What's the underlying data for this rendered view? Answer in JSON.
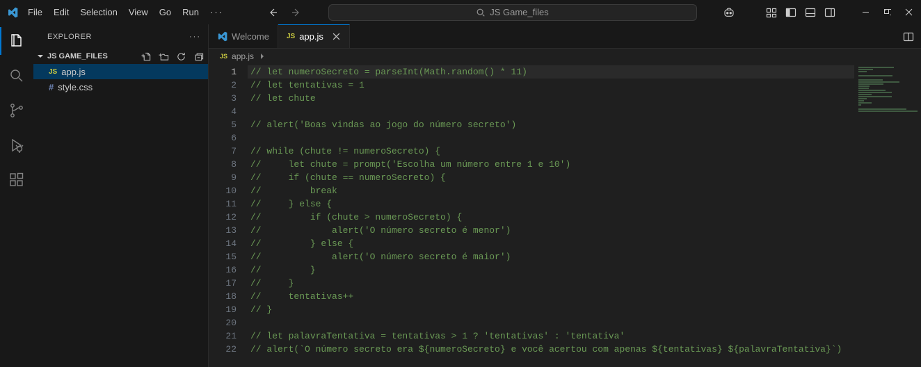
{
  "titlebar": {
    "menu": [
      "File",
      "Edit",
      "Selection",
      "View",
      "Go",
      "Run"
    ],
    "more": "···",
    "search_placeholder": "JS Game_files"
  },
  "sidebar": {
    "title": "EXPLORER",
    "folder": "JS GAME_FILES",
    "files": [
      {
        "name": "app.js",
        "icon": "JS",
        "selected": true
      },
      {
        "name": "style.css",
        "icon": "#",
        "selected": false
      }
    ]
  },
  "tabs": [
    {
      "label": "Welcome",
      "active": false,
      "icon": "vscode"
    },
    {
      "label": "app.js",
      "active": true,
      "icon": "JS"
    }
  ],
  "breadcrumb": {
    "icon": "JS",
    "label": "app.js"
  },
  "code_lines": [
    "// let numeroSecreto = parseInt(Math.random() * 11)",
    "// let tentativas = 1",
    "// let chute",
    "",
    "// alert('Boas vindas ao jogo do número secreto')",
    "",
    "// while (chute != numeroSecreto) {",
    "//     let chute = prompt('Escolha um número entre 1 e 10')",
    "//     if (chute == numeroSecreto) {",
    "//         break",
    "//     } else {",
    "//         if (chute > numeroSecreto) {",
    "//             alert('O número secreto é menor')",
    "//         } else {",
    "//             alert('O número secreto é maior')",
    "//         }",
    "//     }",
    "//     tentativas++",
    "// }",
    "",
    "// let palavraTentativa = tentativas > 1 ? 'tentativas' : 'tentativa'",
    "// alert(`O número secreto era ${numeroSecreto} e você acertou com apenas ${tentativas} ${palavraTentativa}`)"
  ],
  "current_line": 1
}
